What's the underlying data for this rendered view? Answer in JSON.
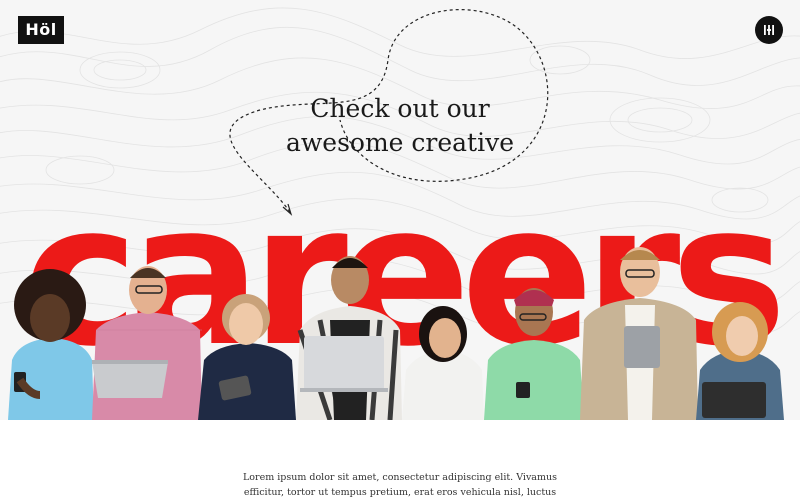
{
  "brand": {
    "logo_text": "Höl"
  },
  "header": {
    "menu_icon": "menu-icon"
  },
  "hero": {
    "headline_line1": "Check out our",
    "headline_line2": "awesome creative",
    "big_word": "careers",
    "accent_color": "#ec1a18",
    "background_color": "#f6f6f6"
  },
  "intro": {
    "line1": "Lorem ipsum dolor sit amet, consectetur adipiscing elit. Vivamus",
    "line2": "efficitur, tortor ut tempus pretium, erat eros vehicula nisl, luctus"
  }
}
